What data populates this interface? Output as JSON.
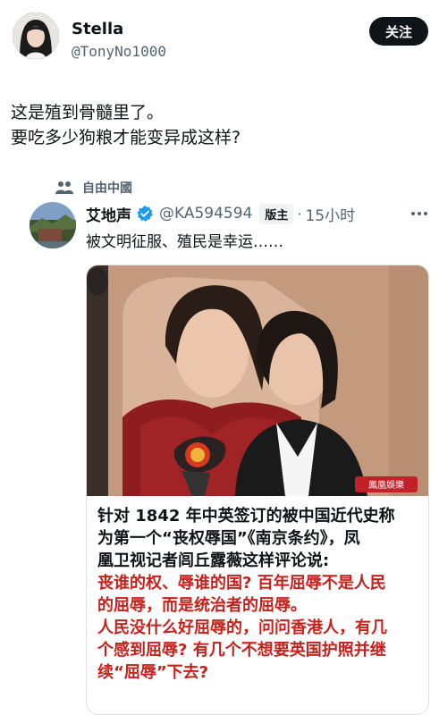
{
  "post": {
    "author_name": "Stella",
    "author_handle": "@TonyNo1000",
    "follow_label": "关注",
    "text_lines": [
      "这是殖到骨髓里了。",
      "要吃多少狗粮才能变异成这样?"
    ]
  },
  "quoted": {
    "community": "自由中國",
    "author_name": "艾地声",
    "author_handle": "@KA594594",
    "badge": "版主",
    "separator": "·",
    "time": "15小时",
    "text": "被文明征服、殖民是幸运……",
    "media": {
      "watermark": "鳳凰娛樂",
      "caption_black": [
        "针对 1842 年中英签订的被中国近代史称",
        "为第一个“丧权辱国”《南京条约》，凤",
        "凰卫视记者闾丘露薇这样评论说:"
      ],
      "caption_red": [
        "丧谁的权、辱谁的国? 百年屈辱不是人民",
        "的屈辱，而是统治者的屈辱。",
        "人民没什么好屈辱的，问问香港人，有几",
        "个感到屈辱? 有几个不想要英国护照并继",
        "续“屈辱”下去?"
      ]
    }
  },
  "colors": {
    "text": "#0f1419",
    "secondary": "#536471",
    "verified": "#1d9bf0",
    "caption_red": "#c8211b",
    "badge_bg": "#eff3f4"
  }
}
